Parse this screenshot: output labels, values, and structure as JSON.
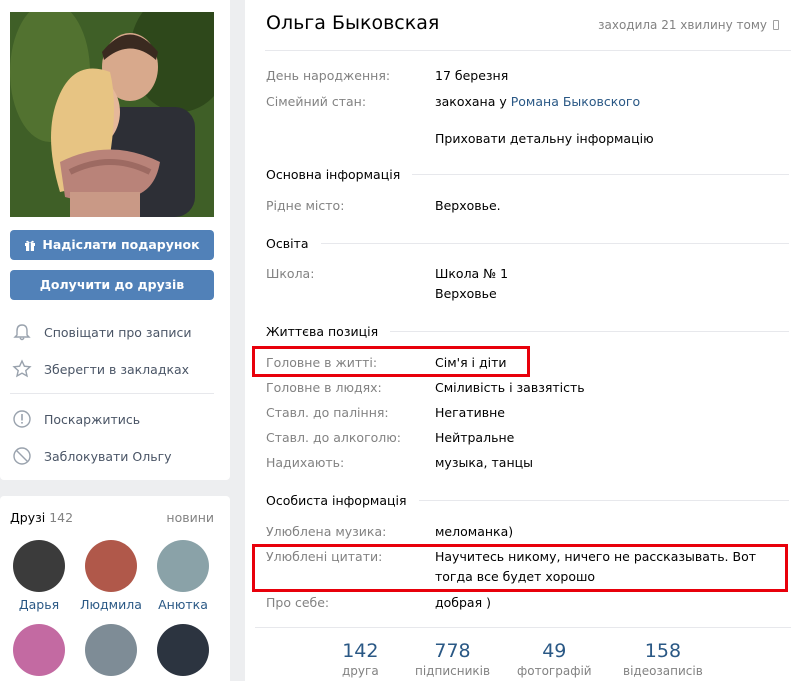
{
  "left": {
    "buttons": {
      "gift": "Надіслати подарунок",
      "add_friend": "Долучити до друзів"
    },
    "menu": [
      {
        "label": "Сповіщати про записи",
        "icon": "bell-icon"
      },
      {
        "label": "Зберегти в закладках",
        "icon": "star-icon"
      },
      {
        "label": "Поскаржитись",
        "icon": "report-icon"
      },
      {
        "label": "Заблокувати Ольгу",
        "icon": "block-icon"
      }
    ]
  },
  "friends": {
    "title": "Друзі",
    "count": "142",
    "new_link": "новини",
    "items": [
      {
        "name": "Дарья",
        "color": "#3b3b3b"
      },
      {
        "name": "Людмила",
        "color": "#b0584a"
      },
      {
        "name": "Анютка",
        "color": "#8aa2a8"
      },
      {
        "name": "",
        "color": "#c36aa2"
      },
      {
        "name": "",
        "color": "#7e8c96"
      },
      {
        "name": "",
        "color": "#2c3440"
      }
    ]
  },
  "profile": {
    "name": "Ольга Быковская",
    "last_seen": "заходила 21 хвилину тому",
    "rows_top": [
      {
        "label": "День народження:",
        "value": "17 березня"
      },
      {
        "label": "Сімейний стан:",
        "value_prefix": "закохана у",
        "value_link": "Романа Быковского"
      }
    ],
    "hide_link": "Приховати детальну інформацію",
    "sections": {
      "main": "Основна інформація",
      "education": "Освіта",
      "life": "Життєва позиція",
      "personal": "Особиста інформація"
    },
    "hometown": {
      "label": "Рідне місто:",
      "value": "Верховье."
    },
    "school": {
      "label": "Школа:",
      "value": "Школа № 1",
      "value2": "Верховье"
    },
    "life_rows": [
      {
        "label": "Головне в житті:",
        "value": "Сім'я і діти"
      },
      {
        "label": "Головне в людях:",
        "value": "Сміливість і завзятість"
      },
      {
        "label": "Ставл. до паління:",
        "value": "Негативне"
      },
      {
        "label": "Ставл. до алкоголю:",
        "value": "Нейтральне"
      },
      {
        "label": "Надихають:",
        "value": "музыка, танцы"
      }
    ],
    "personal_rows": [
      {
        "label": "Улюблена музика:",
        "value": "меломанка)"
      },
      {
        "label": "Улюблені цитати:",
        "value": "Научитесь никому, ничего не рассказывать. Вот тогда все будет хорошо"
      },
      {
        "label": "Про себе:",
        "value": "добрая )"
      }
    ],
    "stats": [
      {
        "num": "142",
        "label": "друга"
      },
      {
        "num": "778",
        "label": "підписників"
      },
      {
        "num": "49",
        "label": "фотографій"
      },
      {
        "num": "158",
        "label": "відеозаписів"
      }
    ]
  },
  "colors": {
    "accent": "#5181b8",
    "link": "#2a5885",
    "highlight": "#e8000b"
  }
}
